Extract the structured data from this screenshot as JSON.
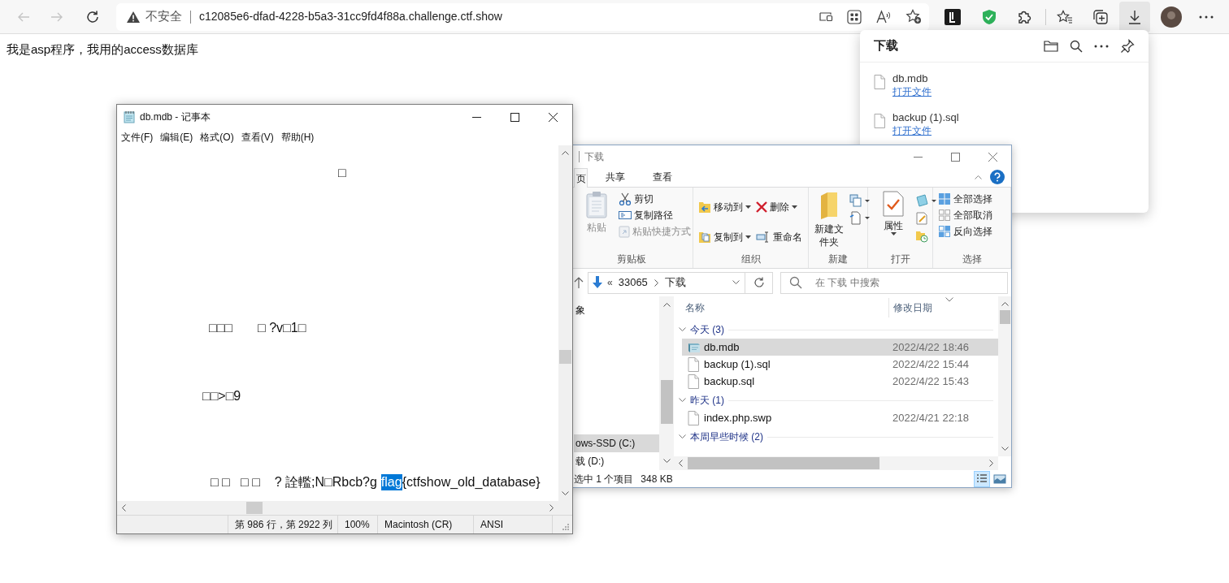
{
  "browser": {
    "security_label": "不安全",
    "url": "c12085e6-dfad-4228-b5a3-31cc9fd4f88a.challenge.ctf.show",
    "page_text": "我是asp程序，我用的access数据库"
  },
  "downloads_panel": {
    "title": "下载",
    "items": [
      {
        "name": "db.mdb",
        "action": "打开文件"
      },
      {
        "name": "backup (1).sql",
        "action": "打开文件"
      }
    ]
  },
  "notepad": {
    "title": "db.mdb - 记事本",
    "menu": [
      "文件(F)",
      "编辑(E)",
      "格式(O)",
      "查看(V)",
      "帮助(H)"
    ],
    "lines": [
      {
        "segments": [
          {
            "text": "□",
            "selected": false
          }
        ]
      },
      {
        "segments": [
          {
            "text": "□□□       □ ?v□1□",
            "selected": false
          }
        ]
      },
      {
        "segments": [
          {
            "text": "□□>□9",
            "selected": false
          }
        ]
      },
      {
        "segments": [
          {
            "text": "□ □   □ □    ? 詮轞;N□Rbcb?g",
            "selected": false
          },
          {
            "text": "flag",
            "selected": true
          },
          {
            "text": "{ctfshow_old_database}",
            "selected": false
          }
        ]
      }
    ],
    "status": [
      "第 986 行，第 2922 列",
      "100%",
      "Macintosh (CR)",
      "ANSI"
    ]
  },
  "explorer": {
    "title": "下载",
    "tabs": [
      {
        "label": "页",
        "selected": true
      },
      {
        "label": "共享",
        "selected": false
      },
      {
        "label": "查看",
        "selected": false
      }
    ],
    "ribbon_groups": [
      {
        "label": "剪贴板",
        "items": [
          {
            "label": "粘贴",
            "kind": "large",
            "disabled": true,
            "has_menu": false
          },
          {
            "label": "剪切",
            "kind": "small",
            "disabled": false,
            "has_menu": false
          },
          {
            "label": "复制路径",
            "kind": "small",
            "disabled": false,
            "has_menu": false
          },
          {
            "label": "粘贴快捷方式",
            "kind": "small",
            "disabled": true,
            "has_menu": false
          }
        ]
      },
      {
        "label": "组织",
        "items": [
          {
            "label": "移动到",
            "kind": "small",
            "disabled": false,
            "has_menu": true
          },
          {
            "label": "删除",
            "kind": "small",
            "disabled": false,
            "has_menu": true
          },
          {
            "label": "复制到",
            "kind": "small",
            "disabled": false,
            "has_menu": true
          },
          {
            "label": "重命名",
            "kind": "small",
            "disabled": false,
            "has_menu": false
          }
        ]
      },
      {
        "label": "新建",
        "items": [
          {
            "label": "新建文件夹",
            "kind": "large",
            "disabled": false,
            "has_menu": false
          }
        ]
      },
      {
        "label": "打开",
        "items": [
          {
            "label": "属性",
            "kind": "large",
            "disabled": false,
            "has_menu": true
          }
        ]
      },
      {
        "label": "选择",
        "items": [
          {
            "label": "全部选择",
            "kind": "small",
            "disabled": false,
            "has_menu": false
          },
          {
            "label": "全部取消",
            "kind": "small",
            "disabled": false,
            "has_menu": false
          },
          {
            "label": "反向选择",
            "kind": "small",
            "disabled": false,
            "has_menu": false
          }
        ]
      }
    ],
    "breadcrumb": {
      "overflow": "«",
      "path": [
        "33065",
        "下载"
      ]
    },
    "search": {
      "placeholder": "在 下载 中搜索"
    },
    "nav_items": [
      {
        "label": "象",
        "selected": false
      },
      {
        "label": "ows-SSD (C:)",
        "selected": true
      },
      {
        "label": "载 (D:)",
        "selected": false
      }
    ],
    "columns": [
      "名称",
      "修改日期"
    ],
    "groups": [
      {
        "label": "今天 (3)",
        "expanded": true,
        "files": [
          {
            "name": "db.mdb",
            "kind": "database",
            "date": "2022/4/22 18:46",
            "selected": true
          },
          {
            "name": "backup (1).sql",
            "kind": "document",
            "date": "2022/4/22 15:44",
            "selected": false
          },
          {
            "name": "backup.sql",
            "kind": "document",
            "date": "2022/4/22 15:43",
            "selected": false
          }
        ]
      },
      {
        "label": "昨天 (1)",
        "expanded": true,
        "files": [
          {
            "name": "index.php.swp",
            "kind": "document",
            "date": "2022/4/21 22:18",
            "selected": false
          }
        ]
      },
      {
        "label": "本周早些时候 (2)",
        "expanded": true
      }
    ],
    "status": {
      "selection": "选中 1 个项目",
      "size": "348 KB"
    },
    "views": [
      {
        "selected": true
      },
      {
        "selected": false
      }
    ]
  }
}
